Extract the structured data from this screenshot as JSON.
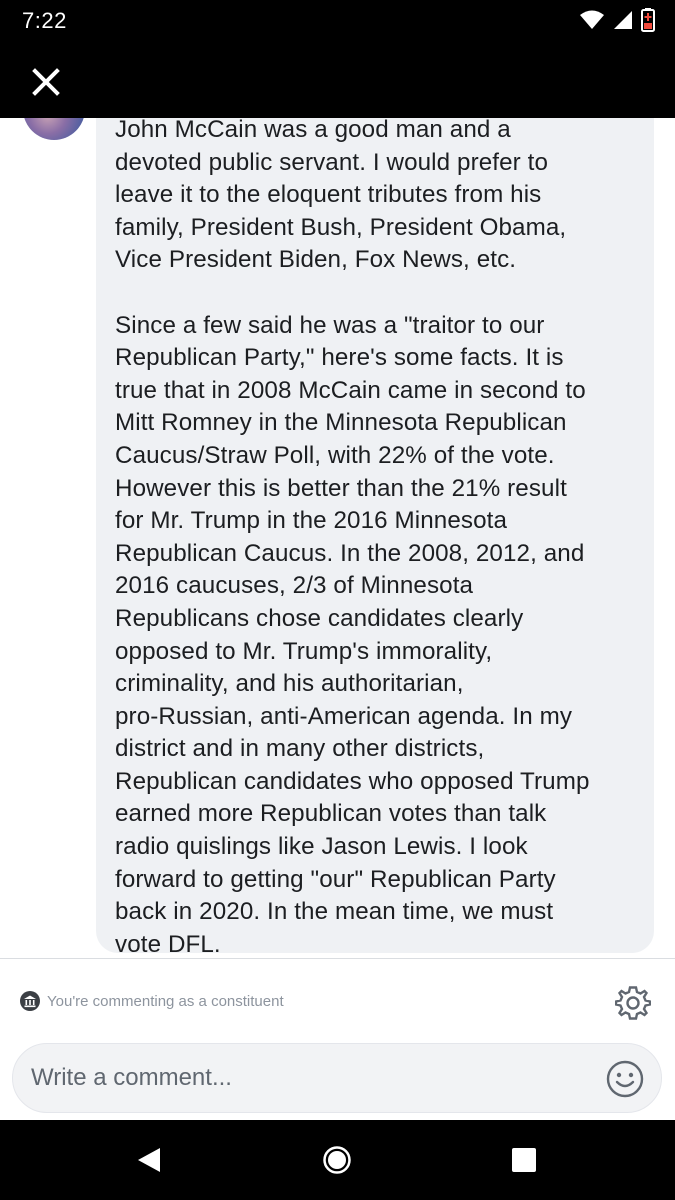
{
  "status_bar": {
    "time": "7:22",
    "icons": [
      "wifi-icon",
      "signal-icon",
      "battery-icon"
    ]
  },
  "toolbar": {
    "close_icon": "close-icon"
  },
  "comment": {
    "text": "John McCain was a good man and a\ndevoted public servant. I would prefer to\nleave it to the eloquent tributes from his\nfamily, President Bush, President Obama,\nVice President Biden, Fox News, etc.\n\nSince a few said he was a \"traitor to our\nRepublican Party,\" here's some facts. It is\ntrue that in 2008 McCain came in second to\nMitt Romney in the Minnesota Republican\nCaucus/Straw Poll, with 22% of the vote.\nHowever this is better than the 21% result\nfor Mr. Trump in the 2016 Minnesota\nRepublican Caucus. In the 2008, 2012, and\n2016 caucuses, 2/3 of Minnesota\nRepublicans chose candidates clearly\nopposed to Mr. Trump's immorality,\ncriminality, and his authoritarian,\npro-Russian, anti-American agenda. In my\ndistrict and in many other districts,\nRepublican candidates who opposed Trump\nearned more Republican votes than talk\nradio quislings like Jason Lewis. I look\nforward to getting \"our\" Republican Party\nback in 2020. In the mean time, we must\nvote DFL."
  },
  "constituent": {
    "label": "You're commenting as a constituent"
  },
  "composer": {
    "placeholder": "Write a comment..."
  },
  "colors": {
    "bubble": "#eff1f4",
    "text": "#1c1e21",
    "muted": "#8d949e",
    "bars": "#000000"
  }
}
